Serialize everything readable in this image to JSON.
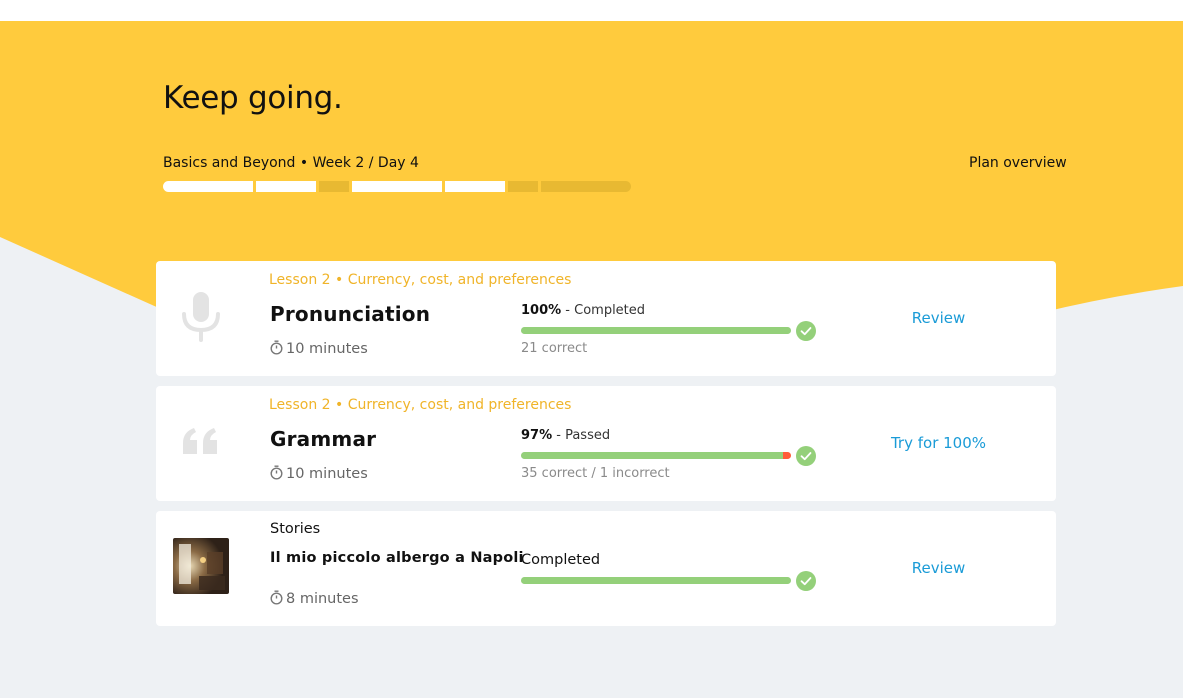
{
  "colors": {
    "accent_yellow": "#ffcb3d",
    "progress_green": "#94d07a",
    "error_red": "#ff5c39",
    "link_blue": "#1a9bd7",
    "lesson_label": "#f0b429",
    "background": "#eef1f4"
  },
  "hero": {
    "title": "Keep going.",
    "plan_name": "Basics and Beyond • Week 2 / Day 4",
    "plan_overview_label": "Plan overview",
    "plan_progress": [
      "done",
      "done",
      "pending",
      "done",
      "done",
      "pending",
      "pending"
    ]
  },
  "cards": [
    {
      "icon": "microphone-icon",
      "lesson": "Lesson 2 • Currency, cost, and preferences",
      "name": "Pronunciation",
      "duration": "10 minutes",
      "status_value": "100%",
      "status_label": " - Completed",
      "progress": {
        "correct": 100,
        "incorrect": 0
      },
      "details": "21 correct",
      "action": "Review"
    },
    {
      "icon": "quote-icon",
      "lesson": "Lesson 2 • Currency, cost, and preferences",
      "name": "Grammar",
      "duration": "10 minutes",
      "status_value": "97%",
      "status_label": " - Passed",
      "progress": {
        "correct": 97,
        "incorrect": 3
      },
      "details": "35 correct / 1 incorrect",
      "action": "Try for 100%"
    },
    {
      "icon": "story-thumbnail",
      "category": "Stories",
      "name": "Il mio piccolo albergo a Napoli",
      "duration": "8 minutes",
      "status": "Completed",
      "progress": {
        "correct": 100,
        "incorrect": 0
      },
      "action": "Review"
    }
  ]
}
